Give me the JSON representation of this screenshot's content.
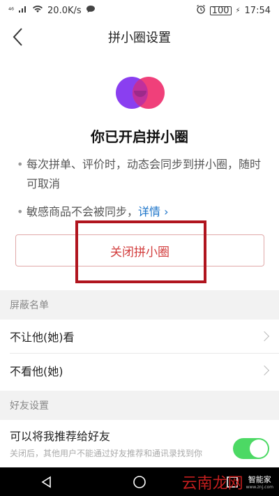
{
  "status_bar": {
    "signal": "⁴⁶",
    "speed": "20.0K/s",
    "battery": "100",
    "time": "17:54"
  },
  "header": {
    "title": "拼小圈设置"
  },
  "hero": {
    "title": "你已开启拼小圈"
  },
  "bullets": {
    "first": "每次拼单、评价时，动态会同步到拼小圈，随时可取消",
    "second": "敏感商品不会被同步，",
    "detail_link": "详情 ›"
  },
  "close_button": {
    "label": "关闭拼小圈"
  },
  "block_list": {
    "header": "屏蔽名单",
    "items": [
      {
        "label": "不让他(她)看"
      },
      {
        "label": "不看他(她)"
      }
    ]
  },
  "friend_settings": {
    "header": "好友设置",
    "recommend_title": "可以将我推荐给好友",
    "recommend_desc": "关闭后，其他用户不能通过好友推荐和通讯录找到你",
    "recommend_enabled": true
  },
  "watermark": {
    "main": "云南龙网",
    "small": "智能家",
    "url": "www.znj.com"
  },
  "colors": {
    "accent_red": "#d23c3c",
    "link_blue": "#1a73c9",
    "toggle_green": "#4cd964",
    "logo_purple": "#8a3ff0",
    "logo_pink": "#f0407a"
  }
}
